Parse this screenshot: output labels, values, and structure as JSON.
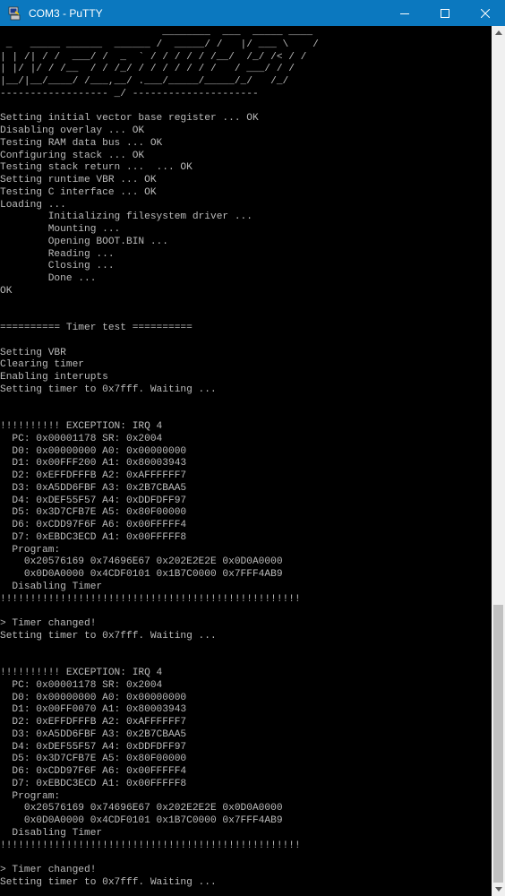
{
  "window": {
    "title": "COM3 - PuTTY",
    "app_icon": "putty-computer-icon",
    "controls": [
      "minimize-icon",
      "maximize-icon",
      "close-icon"
    ]
  },
  "colors": {
    "titlebar": "#0b78bf",
    "terminal_bg": "#000000",
    "terminal_fg": "#bbbbbb",
    "scrollbar_track": "#f0f0f0",
    "scrollbar_thumb": "#c1c1c1"
  },
  "terminal": {
    "lines": [
      "                           ________  ___  _____ ____",
      " _   _____ ______  ______ /  _____/ /   |/ ___ \\    /",
      "| | /| / /  ___/ /  _  ` / / / / / /__/  /_/ /< / /",
      "| |/ |/ / /__  / / /_/ / / / / / / /   / ___/ / /",
      "|__/|__/____/ /___,__/ .___/_____/_____/_/   /_/",
      "------------------ _/ ---------------------",
      "",
      "Setting initial vector base register ... OK",
      "Disabling overlay ... OK",
      "Testing RAM data bus ... OK",
      "Configuring stack ... OK",
      "Testing stack return ...  ... OK",
      "Setting runtime VBR ... OK",
      "Testing C interface ... OK",
      "Loading ...",
      "        Initializing filesystem driver ...",
      "        Mounting ...",
      "        Opening BOOT.BIN ...",
      "        Reading ...",
      "        Closing ...",
      "        Done ...",
      "OK",
      "",
      "",
      "========== Timer test ==========",
      "",
      "Setting VBR",
      "Clearing timer",
      "Enabling interupts",
      "Setting timer to 0x7fff. Waiting ...",
      "",
      "",
      "!!!!!!!!!! EXCEPTION: IRQ 4",
      "  PC: 0x00001178 SR: 0x2004",
      "  D0: 0x00000000 A0: 0x00000000",
      "  D1: 0x00FFF200 A1: 0x80003943",
      "  D2: 0xEFFDFFFB A2: 0xAFFFFFF7",
      "  D3: 0xA5DD6FBF A3: 0x2B7CBAA5",
      "  D4: 0xDEF55F57 A4: 0xDDFDFF97",
      "  D5: 0x3D7CFB7E A5: 0x80F00000",
      "  D6: 0xCDD97F6F A6: 0x00FFFFF4",
      "  D7: 0xEBDC3ECD A1: 0x00FFFFF8",
      "  Program:",
      "    0x20576169 0x74696E67 0x202E2E2E 0x0D0A0000",
      "    0x0D0A0000 0x4CDF0101 0x1B7C0000 0x7FFF4AB9",
      "  Disabling Timer",
      "!!!!!!!!!!!!!!!!!!!!!!!!!!!!!!!!!!!!!!!!!!!!!!!!!!",
      "",
      "> Timer changed!",
      "Setting timer to 0x7fff. Waiting ...",
      "",
      "",
      "!!!!!!!!!! EXCEPTION: IRQ 4",
      "  PC: 0x00001178 SR: 0x2004",
      "  D0: 0x00000000 A0: 0x00000000",
      "  D1: 0x00FF0070 A1: 0x80003943",
      "  D2: 0xEFFDFFFB A2: 0xAFFFFFF7",
      "  D3: 0xA5DD6FBF A3: 0x2B7CBAA5",
      "  D4: 0xDEF55F57 A4: 0xDDFDFF97",
      "  D5: 0x3D7CFB7E A5: 0x80F00000",
      "  D6: 0xCDD97F6F A6: 0x00FFFFF4",
      "  D7: 0xEBDC3ECD A1: 0x00FFFFF8",
      "  Program:",
      "    0x20576169 0x74696E67 0x202E2E2E 0x0D0A0000",
      "    0x0D0A0000 0x4CDF0101 0x1B7C0000 0x7FFF4AB9",
      "  Disabling Timer",
      "!!!!!!!!!!!!!!!!!!!!!!!!!!!!!!!!!!!!!!!!!!!!!!!!!!",
      "",
      "> Timer changed!",
      "Setting timer to 0x7fff. Waiting ..."
    ]
  },
  "scrollbar": {
    "up_icon": "scroll-up-arrow-icon",
    "down_icon": "scroll-down-arrow-icon",
    "position_fraction": 1.0
  }
}
